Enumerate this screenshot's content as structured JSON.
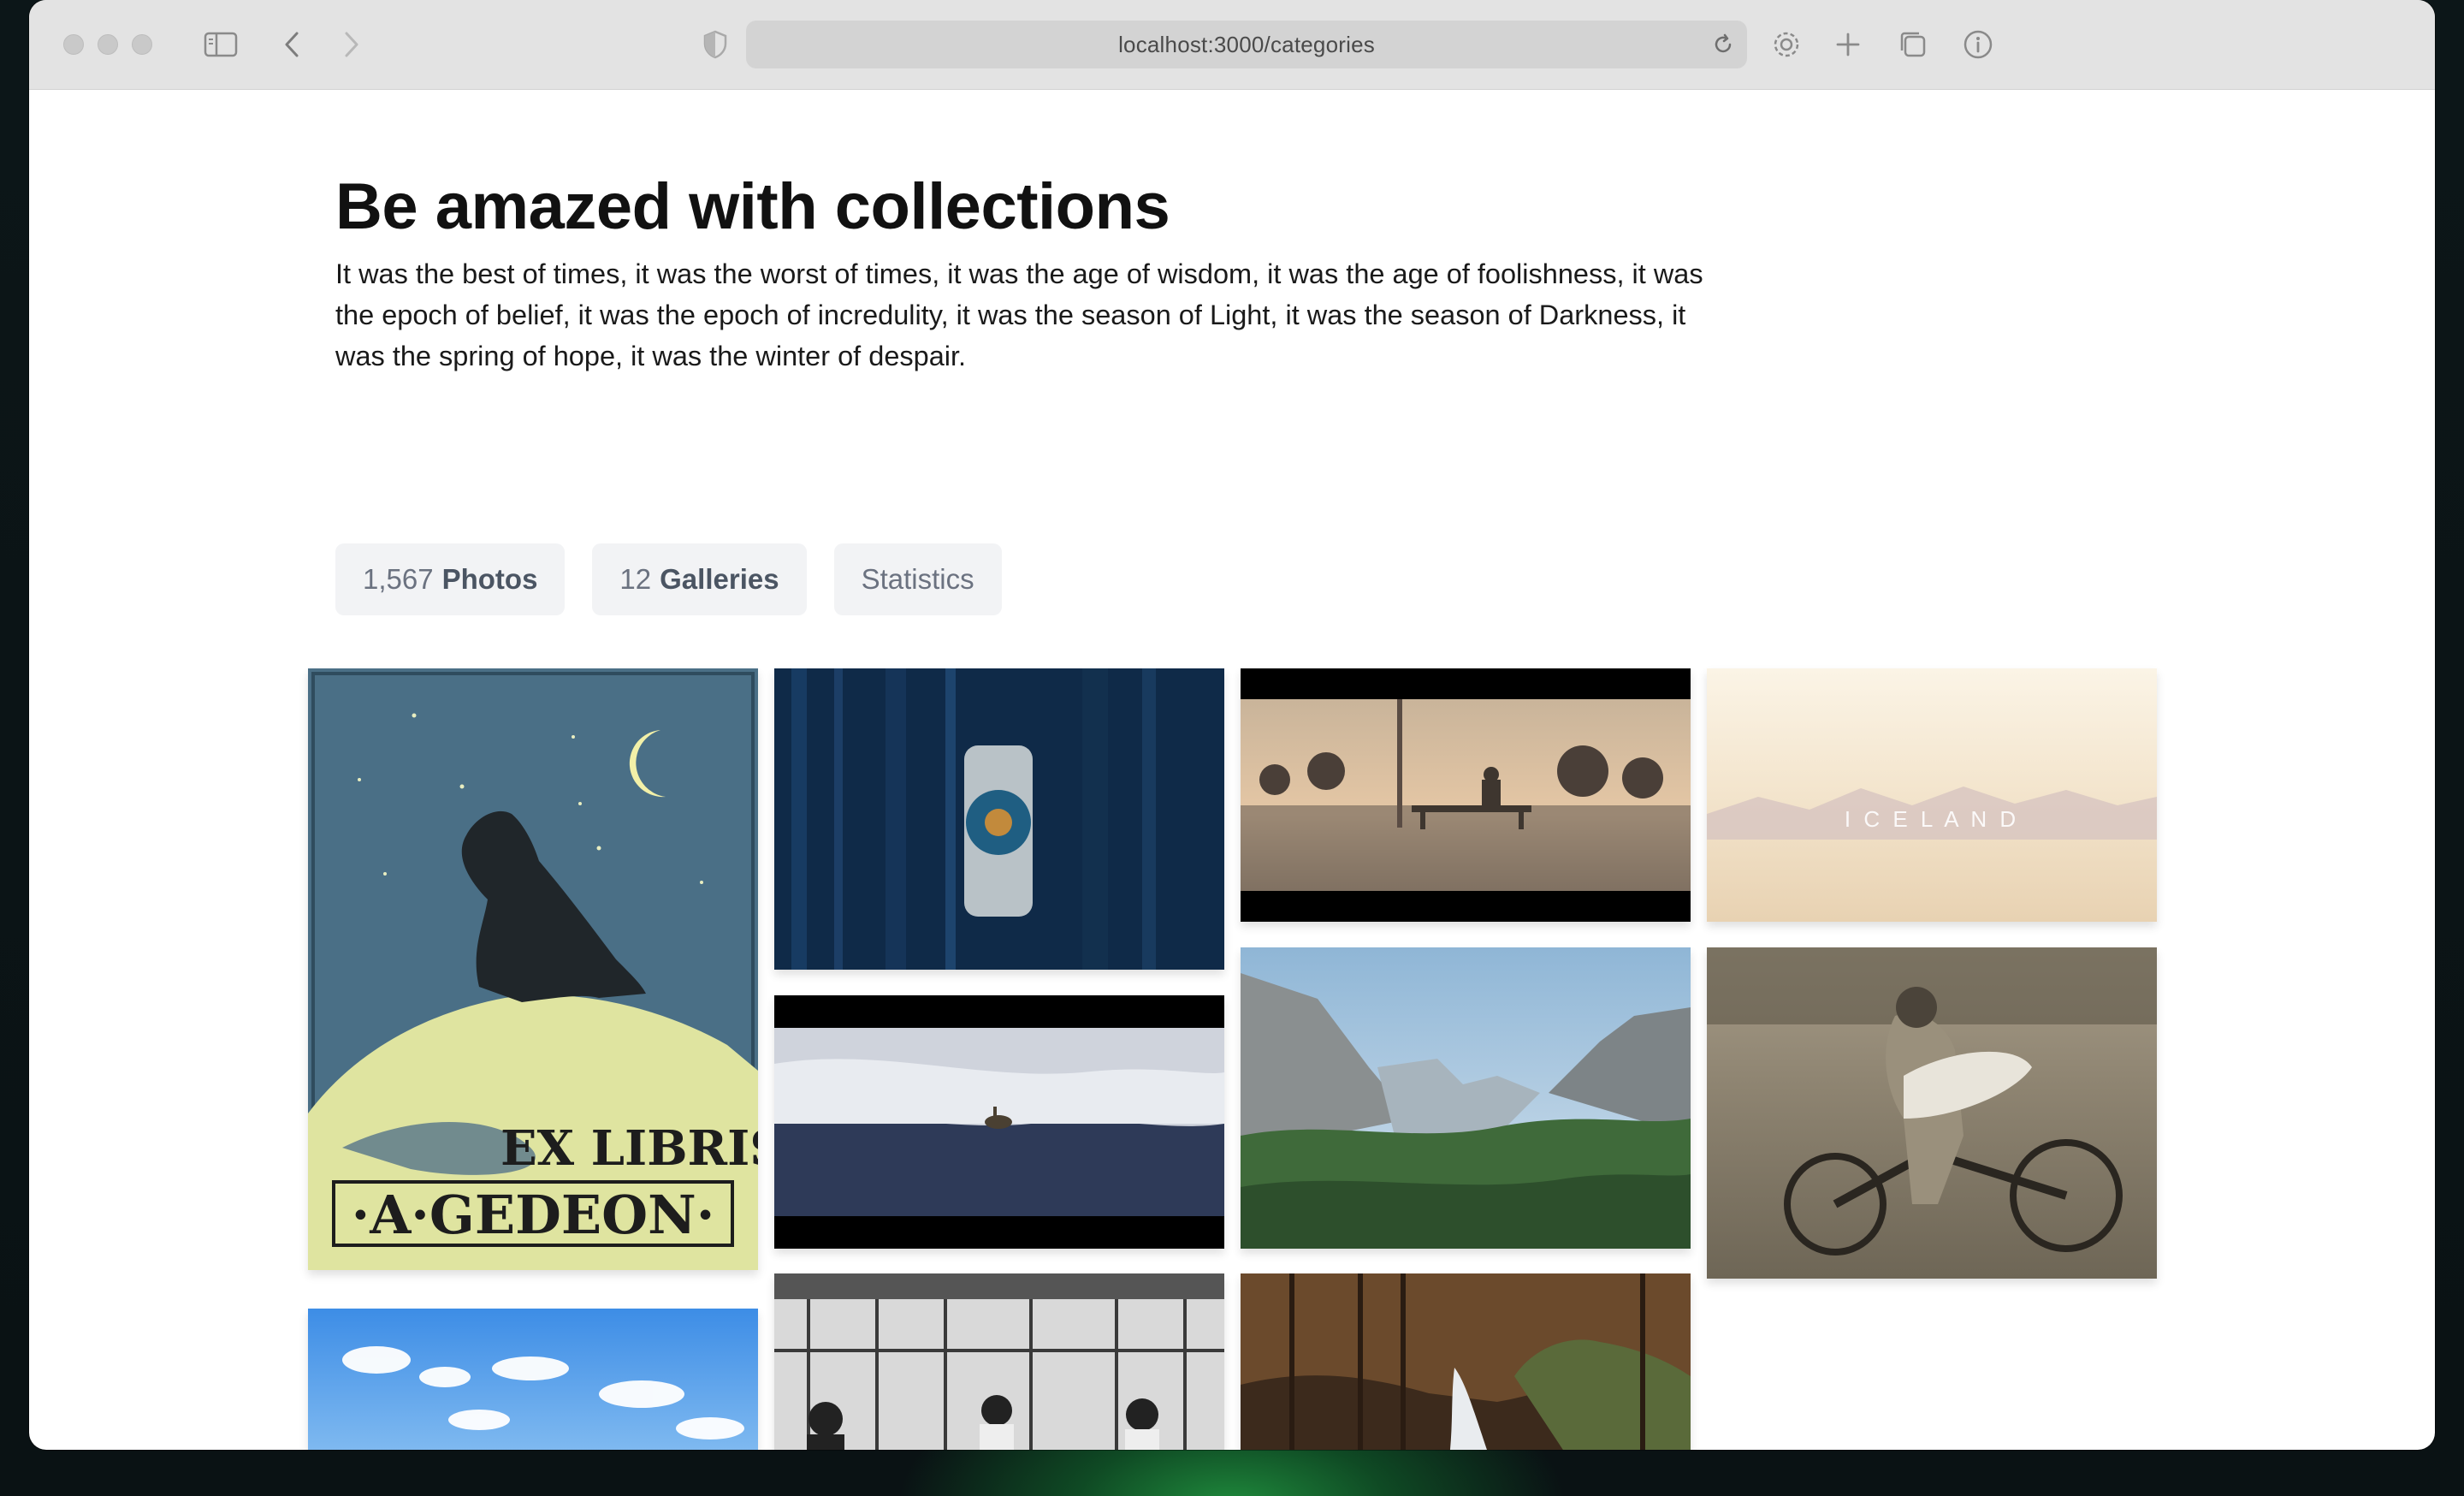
{
  "browser": {
    "url": "localhost:3000/categories"
  },
  "page": {
    "title": "Be amazed with collections",
    "description": "It was the best of times, it was the worst of times, it was the age of wisdom, it was the age of foolishness, it was the epoch of belief, it was the epoch of incredulity, it was the season of Light, it was the season of Darkness, it was the spring of hope, it was the winter of despair."
  },
  "stats": {
    "photos_count": "1,567",
    "photos_label": "Photos",
    "galleries_count": "12",
    "galleries_label": "Galleries",
    "statistics_label": "Statistics"
  },
  "gallery": {
    "tiles": [
      {
        "name": "ex-libris-wolf-bookplate",
        "text_line1": "EX LIBRIS",
        "text_line2": "·A·GEDEON·"
      },
      {
        "name": "blue-wooden-door-knob"
      },
      {
        "name": "person-on-flooded-bench"
      },
      {
        "name": "iceland-title-card",
        "text": "I C E L A N D"
      },
      {
        "name": "goose-on-snowy-shore"
      },
      {
        "name": "yosemite-valley"
      },
      {
        "name": "vintage-motorcycle-rider"
      },
      {
        "name": "blue-sky-clouds"
      },
      {
        "name": "historic-factory-workers"
      },
      {
        "name": "forest-waterfall"
      }
    ]
  },
  "icons": {
    "sidebar": "sidebar-icon",
    "back": "chevron-left-icon",
    "forward": "chevron-right-icon",
    "privacy": "shield-icon",
    "reload": "reload-icon",
    "settings": "gear-icon",
    "new_tab": "plus-icon",
    "tabs": "tabs-overview-icon",
    "info": "info-icon"
  }
}
